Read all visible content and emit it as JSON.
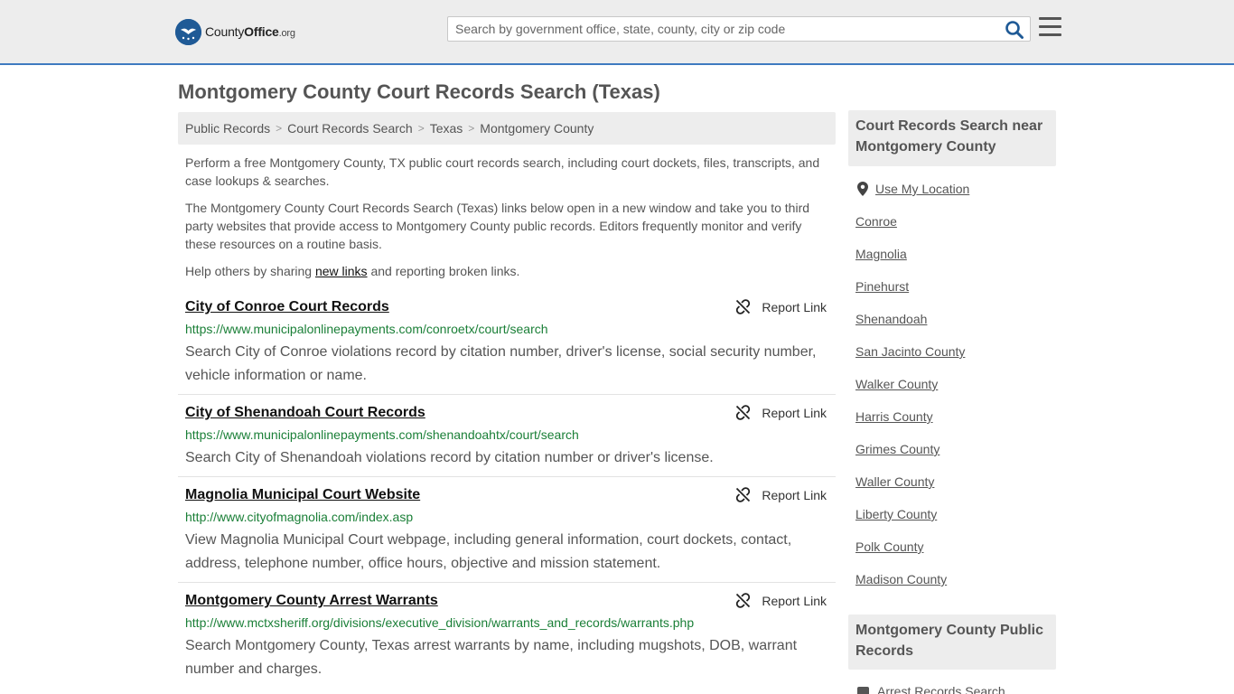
{
  "header": {
    "logo": {
      "brand": "County",
      "office": "Office",
      "tld": ".org"
    },
    "search_placeholder": "Search by government office, state, county, city or zip code"
  },
  "page_title": "Montgomery County Court Records Search (Texas)",
  "breadcrumb": [
    "Public Records",
    "Court Records Search",
    "Texas",
    "Montgomery County"
  ],
  "intro": {
    "p1": "Perform a free Montgomery County, TX public court records search, including court dockets, files, transcripts, and case lookups & searches.",
    "p2": "The Montgomery County Court Records Search (Texas) links below open in a new window and take you to third party websites that provide access to Montgomery County public records. Editors frequently monitor and verify these resources on a routine basis.",
    "p3_prefix": "Help others by sharing ",
    "p3_link": "new links",
    "p3_suffix": " and reporting broken links."
  },
  "report_label": "Report Link",
  "records": [
    {
      "title": "City of Conroe Court Records",
      "url": "https://www.municipalonlinepayments.com/conroetx/court/search",
      "description": "Search City of Conroe violations record by citation number, driver's license, social security number, vehicle information or name."
    },
    {
      "title": "City of Shenandoah Court Records",
      "url": "https://www.municipalonlinepayments.com/shenandoahtx/court/search",
      "description": "Search City of Shenandoah violations record by citation number or driver's license."
    },
    {
      "title": "Magnolia Municipal Court Website",
      "url": "http://www.cityofmagnolia.com/index.asp",
      "description": "View Magnolia Municipal Court webpage, including general information, court dockets, contact, address, telephone number, office hours, objective and mission statement."
    },
    {
      "title": "Montgomery County Arrest Warrants",
      "url": "http://www.mctxsheriff.org/divisions/executive_division/warrants_and_records/warrants.php",
      "description": "Search Montgomery County, Texas arrest warrants by name, including mugshots, DOB, warrant number and charges."
    }
  ],
  "sidebar": {
    "nearby_heading": "Court Records Search near Montgomery County",
    "use_location": "Use My Location",
    "nearby": [
      "Conroe",
      "Magnolia",
      "Pinehurst",
      "Shenandoah",
      "San Jacinto County",
      "Walker County",
      "Harris County",
      "Grimes County",
      "Waller County",
      "Liberty County",
      "Polk County",
      "Madison County"
    ],
    "public_records_heading": "Montgomery County Public Records",
    "public_records_first": "Arrest Records Search"
  },
  "colors": {
    "accent": "#3f7bc0",
    "url_green": "#1a7f37",
    "search_icon": "#1f5a96"
  }
}
